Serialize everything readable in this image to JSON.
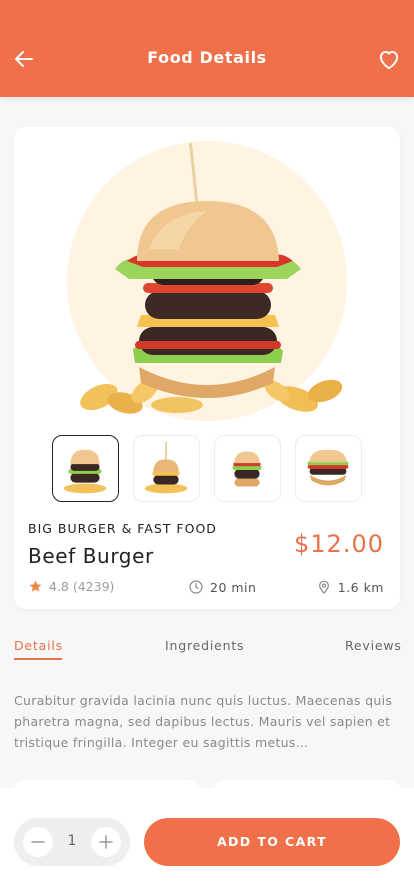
{
  "header": {
    "title": "Food Details"
  },
  "product": {
    "category": "BIG BURGER & FAST FOOD",
    "name": "Beef Burger",
    "price": "$12.00",
    "rating": "4.8 (4239)",
    "time": "20 min",
    "distance": "1.6 km",
    "selected_thumbnail": 1,
    "thumbnail_count": 4
  },
  "tabs": [
    {
      "label": "Details",
      "active": true
    },
    {
      "label": "Ingredients",
      "active": false
    },
    {
      "label": "Reviews",
      "active": false
    }
  ],
  "description": "Curabitur gravida lacinia nunc quis luctus. Maecenas quis pharetra magna, sed dapibus lectus. Mauris vel sapien et tristique fringilla. Integer eu sagittis metus…",
  "cart": {
    "quantity": "1",
    "add_label": "ADD TO CART"
  },
  "colors": {
    "accent": "#ef7049",
    "price": "#e9714b",
    "star": "#f08a4b"
  },
  "icons": {
    "back": "arrow-left-icon",
    "favorite": "heart-outline-icon",
    "rating": "star-icon",
    "time": "clock-icon",
    "distance": "location-pin-icon",
    "decrease": "minus-icon",
    "increase": "plus-icon"
  }
}
